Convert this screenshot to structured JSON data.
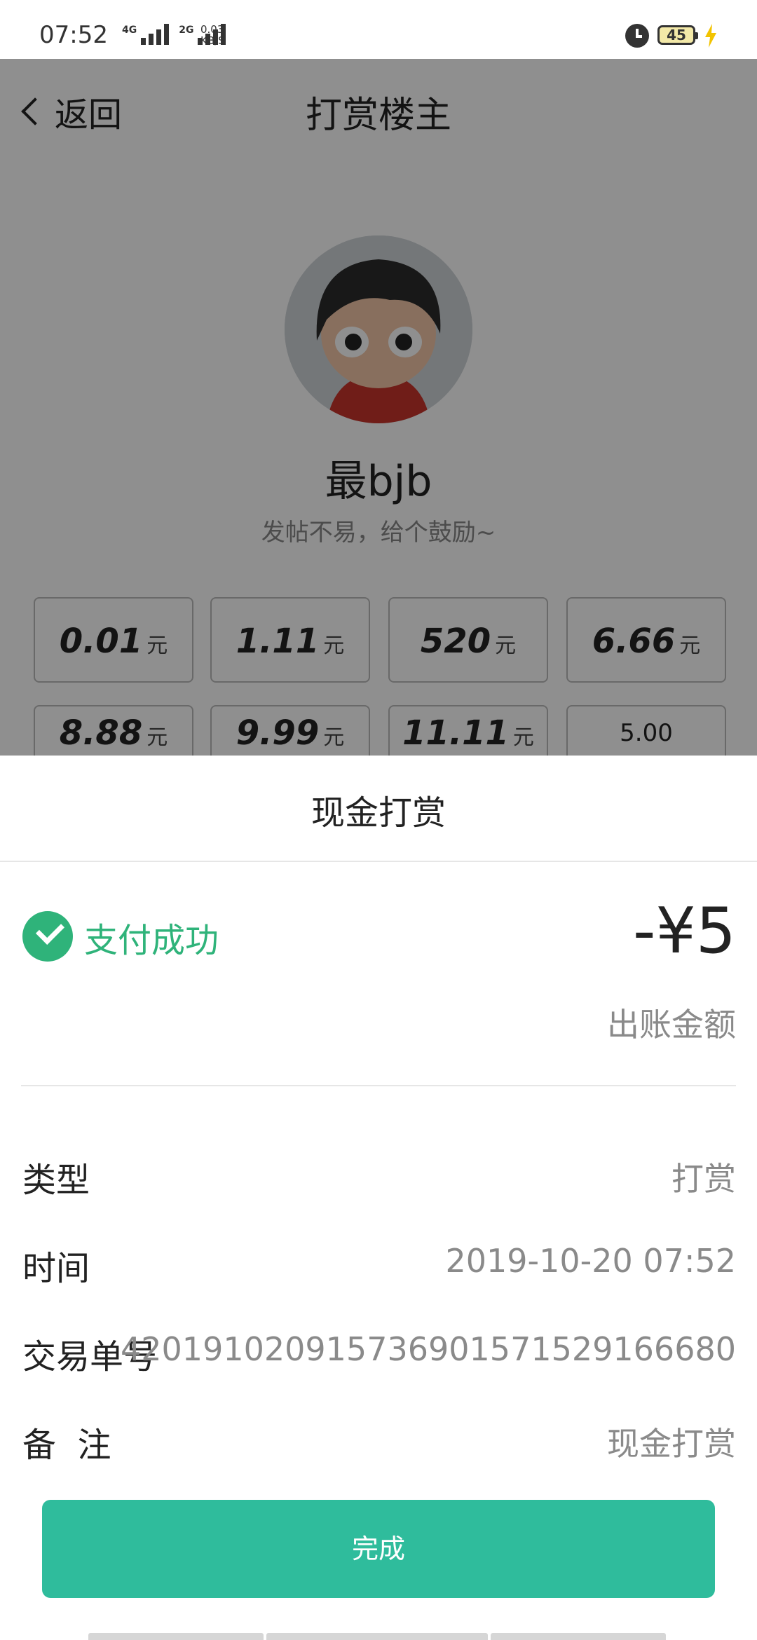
{
  "status_bar": {
    "time": "07:52",
    "net1": "4G",
    "net2": "2G",
    "speed_value": "0.03",
    "speed_unit": "KB/S",
    "battery": "45",
    "icons": [
      "alarm-icon",
      "battery-icon",
      "charging-bolt-icon"
    ]
  },
  "nav": {
    "back_label": "返回",
    "title": "打赏楼主"
  },
  "profile": {
    "username": "最bjb",
    "subtitle": "发帖不易，给个鼓励~"
  },
  "amounts": [
    {
      "num": "0.01",
      "unit": "元"
    },
    {
      "num": "1.11",
      "unit": "元"
    },
    {
      "num": "520",
      "unit": "元"
    },
    {
      "num": "6.66",
      "unit": "元"
    },
    {
      "num": "8.88",
      "unit": "元"
    },
    {
      "num": "9.99",
      "unit": "元"
    },
    {
      "num": "11.11",
      "unit": "元"
    },
    {
      "num": "5.00",
      "unit": ""
    }
  ],
  "sheet": {
    "title": "现金打赏",
    "status": "支付成功",
    "amount": "-¥5",
    "amount_label": "出账金额",
    "rows": [
      {
        "label": "类型",
        "value": "打赏"
      },
      {
        "label": "时间",
        "value": "2019-10-20 07:52"
      },
      {
        "label": "交易单号",
        "value": "4201910209157369015715291666​80"
      },
      {
        "label": "备  注",
        "value": "现金打赏"
      }
    ],
    "done_button": "完成"
  },
  "colors": {
    "accent_green": "#2fb37a",
    "button_teal": "#2fbc9c",
    "overlay": "rgba(0,0,0,0.44)"
  }
}
